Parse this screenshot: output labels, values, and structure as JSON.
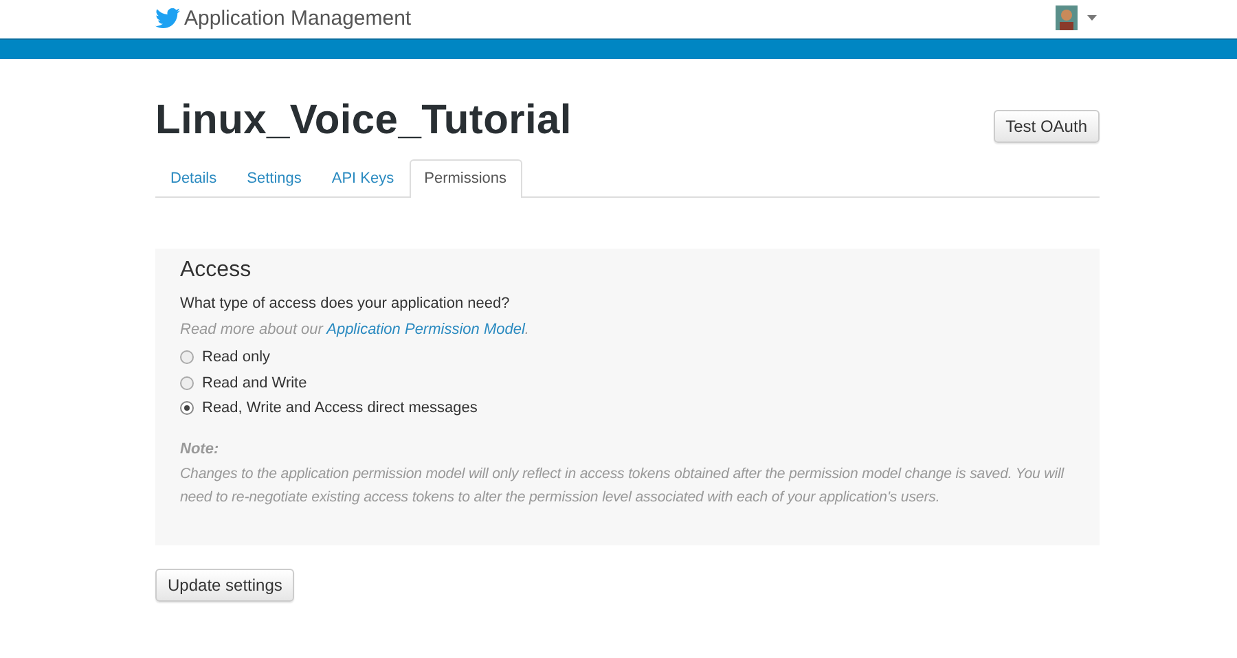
{
  "header": {
    "title": "Application Management"
  },
  "app": {
    "name": "Linux_Voice_Tutorial",
    "action_button": "Test OAuth"
  },
  "tabs": [
    {
      "label": "Details",
      "selected": false
    },
    {
      "label": "Settings",
      "selected": false
    },
    {
      "label": "API Keys",
      "selected": false
    },
    {
      "label": "Permissions",
      "selected": true
    }
  ],
  "access": {
    "heading": "Access",
    "question": "What type of access does your application need?",
    "hint": {
      "before": "Read more about our ",
      "link": "Application Permission Model",
      "after": "."
    },
    "options": [
      {
        "label": "Read only",
        "selected": false
      },
      {
        "label": "Read and Write",
        "selected": false
      },
      {
        "label": "Read, Write and Access direct messages",
        "selected": true
      }
    ],
    "note_title": "Note:",
    "note": "Changes to the application permission model will only reflect in access tokens obtained after the permission model change is saved. You will need to re-negotiate existing access tokens to alter the permission level associated with each of your application's users."
  },
  "submit_button": "Update settings"
}
